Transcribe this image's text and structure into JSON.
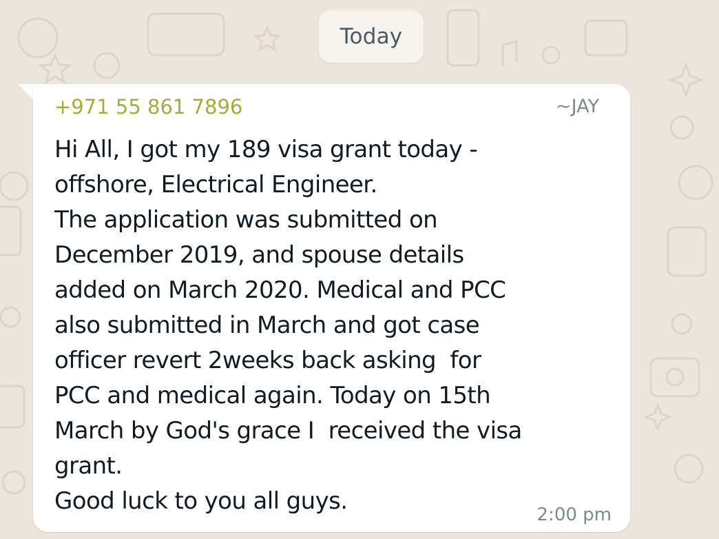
{
  "date_chip": {
    "label": "Today"
  },
  "message": {
    "sender_phone": "+971 55 861 7896",
    "sender_name": "~JAY",
    "lines": [
      "Hi All, I got my 189 visa grant today -",
      "offshore, Electrical Engineer.",
      "The application was submitted on",
      "December 2019, and spouse details",
      "added on March 2020. Medical and PCC",
      "also submitted in March and got case",
      "officer revert 2weeks back asking  for",
      "PCC and medical again. Today on 15th",
      "March by God's grace I  received the visa",
      "grant.",
      "Good luck to you all guys."
    ],
    "time": "2:00 pm"
  },
  "colors": {
    "wallpaper": "#ece5dd",
    "bubble": "#ffffff",
    "sender_phone": "#a3ad3b",
    "meta_text": "#7a8a90",
    "body_text": "#111b21"
  }
}
